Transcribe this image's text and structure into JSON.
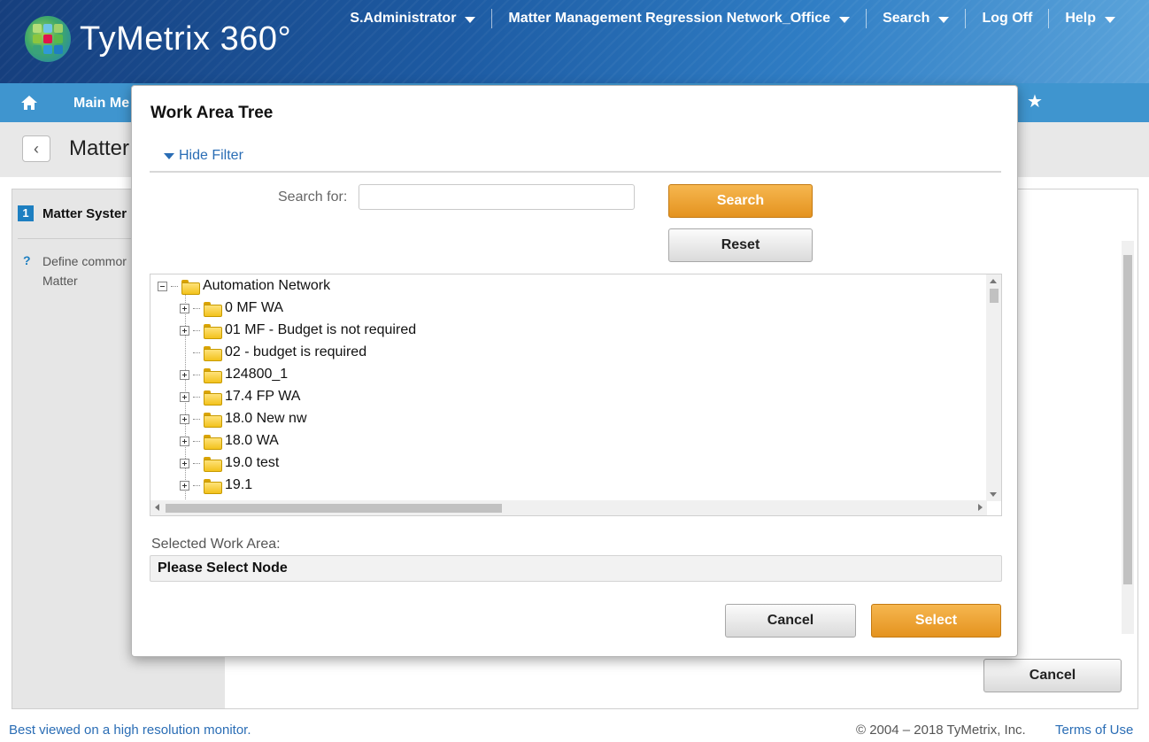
{
  "header": {
    "logo_text": "TyMetrix 360°",
    "nav": [
      {
        "label": "S.Administrator",
        "dropdown": true
      },
      {
        "label": "Matter Management Regression Network_Office",
        "dropdown": true
      },
      {
        "label": "Search",
        "dropdown": true
      },
      {
        "label": "Log Off",
        "dropdown": false
      },
      {
        "label": "Help",
        "dropdown": true
      }
    ]
  },
  "mainnav": {
    "home_icon": "home-icon",
    "label": "Main Me",
    "favorite_icon": "star-icon"
  },
  "titlebar": {
    "back_icon": "chevron-left-icon",
    "title": "Matter"
  },
  "content": {
    "step_number": "1",
    "step_label": "Matter Syster",
    "help_icon": "?",
    "help_text": "Define commor Matter",
    "cancel_label": "Cancel"
  },
  "modal": {
    "title": "Work Area Tree",
    "filter_toggle": "Hide Filter",
    "search_label": "Search for:",
    "search_value": "",
    "search_button": "Search",
    "reset_button": "Reset",
    "tree": {
      "root": "Automation Network",
      "children": [
        {
          "label": "0 MF WA",
          "expandable": true
        },
        {
          "label": "01 MF - Budget is not required",
          "expandable": true
        },
        {
          "label": "02 - budget is required",
          "expandable": false
        },
        {
          "label": "124800_1",
          "expandable": true
        },
        {
          "label": "17.4 FP WA",
          "expandable": true
        },
        {
          "label": "18.0 New nw",
          "expandable": true
        },
        {
          "label": "18.0 WA",
          "expandable": true
        },
        {
          "label": "19.0 test",
          "expandable": true
        },
        {
          "label": "19.1",
          "expandable": true
        }
      ]
    },
    "selected_label": "Selected Work Area:",
    "selected_value": "Please Select Node",
    "cancel_button": "Cancel",
    "select_button": "Select"
  },
  "footer": {
    "note": "Best viewed on a high resolution monitor.",
    "copyright": "© 2004 – 2018 TyMetrix, Inc.",
    "terms": "Terms of Use"
  },
  "colors": {
    "accent_blue": "#3f95cf",
    "link_blue": "#2a6db5",
    "primary_orange": "#e4931f"
  }
}
